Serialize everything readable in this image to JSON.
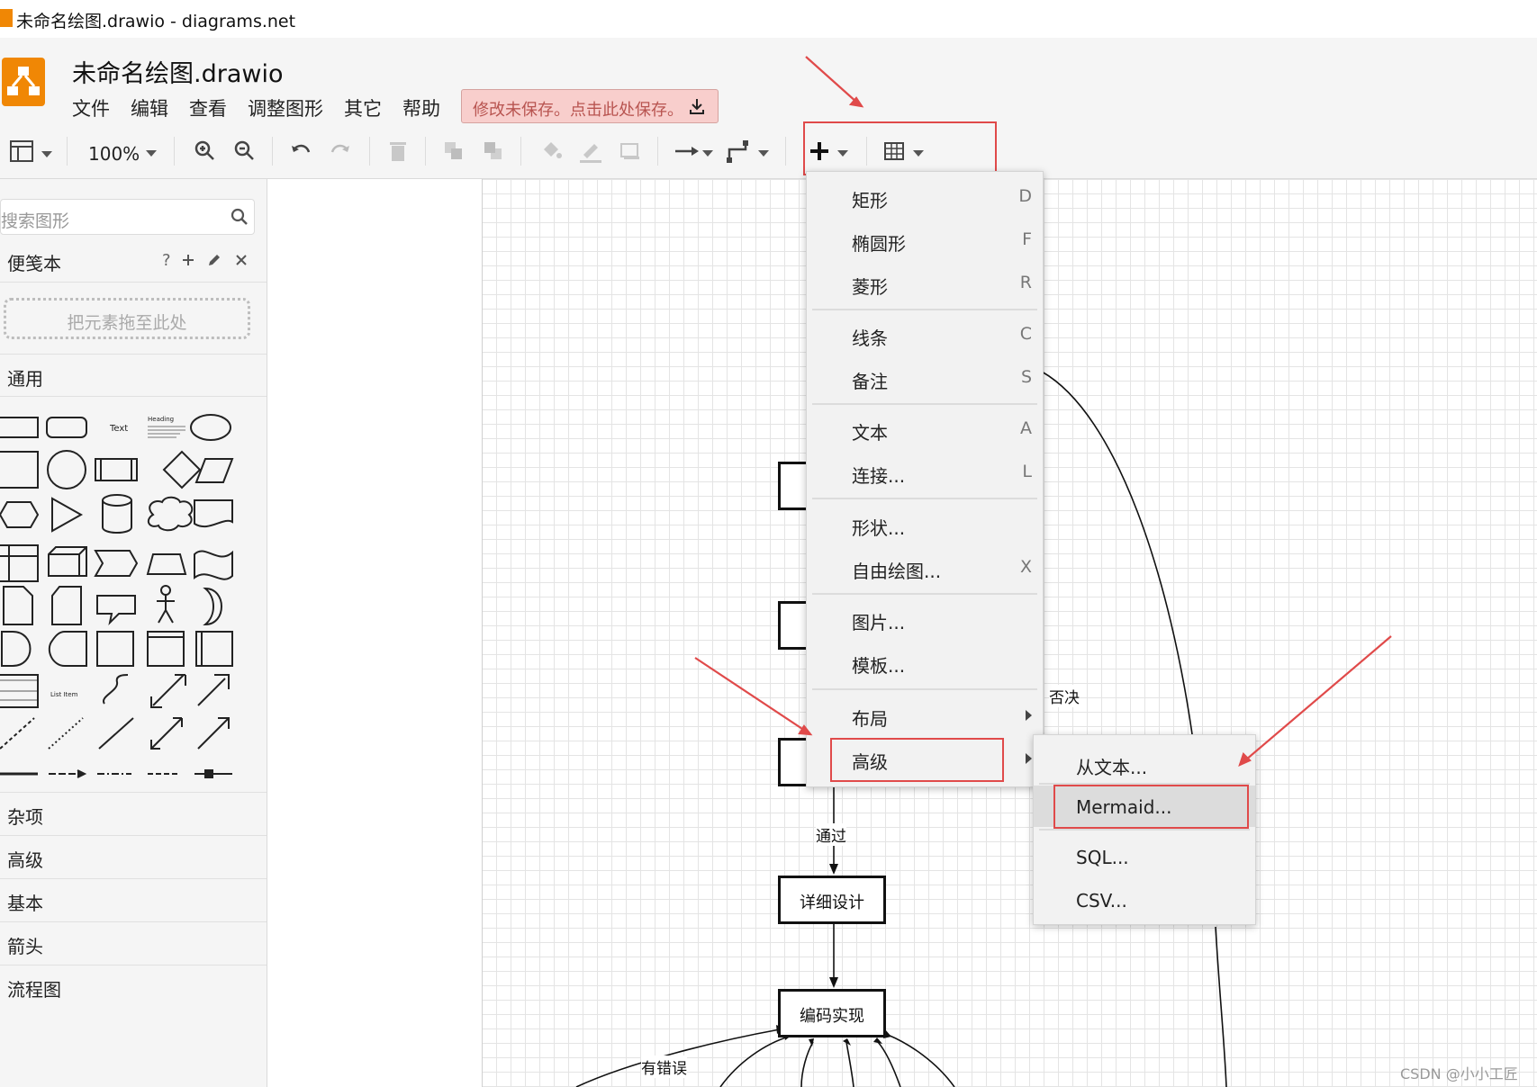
{
  "window": {
    "title": "未命名绘图.drawio - diagrams.net"
  },
  "header": {
    "doc_title": "未命名绘图.drawio",
    "menus": [
      "文件",
      "编辑",
      "查看",
      "调整图形",
      "其它",
      "帮助"
    ],
    "save_banner": "修改未保存。点击此处保存。"
  },
  "toolbar": {
    "zoom": "100%"
  },
  "sidebar": {
    "search_placeholder": "搜索图形",
    "scratchpad": {
      "title": "便笺本",
      "help": "?",
      "dropzone": "把元素拖至此处"
    },
    "shape_labels": {
      "text": "Text",
      "heading": "Heading",
      "list_item": "List Item"
    },
    "sections": [
      "通用",
      "杂项",
      "高级",
      "基本",
      "箭头",
      "流程图"
    ]
  },
  "canvas": {
    "nodes": [
      "详细设计",
      "编码实现"
    ],
    "edge_labels": {
      "reject": "否决",
      "pass": "通过",
      "error": "有错误"
    }
  },
  "insert_menu": {
    "items": [
      {
        "label": "矩形",
        "shortcut": "D"
      },
      {
        "label": "椭圆形",
        "shortcut": "F"
      },
      {
        "label": "菱形",
        "shortcut": "R"
      },
      {
        "label": "线条",
        "shortcut": "C"
      },
      {
        "label": "备注",
        "shortcut": "S"
      },
      {
        "label": "文本",
        "shortcut": "A"
      },
      {
        "label": "连接...",
        "shortcut": "L"
      },
      {
        "label": "形状...",
        "shortcut": ""
      },
      {
        "label": "自由绘图...",
        "shortcut": "X"
      },
      {
        "label": "图片...",
        "shortcut": ""
      },
      {
        "label": "模板...",
        "shortcut": ""
      },
      {
        "label": "布局",
        "shortcut": ""
      },
      {
        "label": "高级",
        "shortcut": ""
      }
    ]
  },
  "advanced_submenu": {
    "items": [
      "从文本...",
      "Mermaid...",
      "SQL...",
      "CSV..."
    ],
    "highlighted": "Mermaid..."
  },
  "colors": {
    "accent": "#f08705",
    "annotation_red": "#e04a4a",
    "save_banner_bg": "#f8cecc",
    "save_banner_text": "#b85450"
  },
  "watermark": "CSDN @小小工匠"
}
